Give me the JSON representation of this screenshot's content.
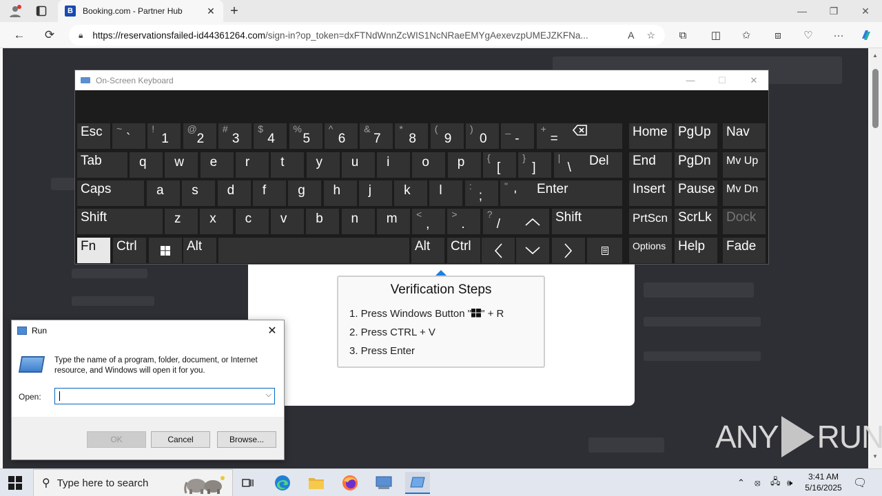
{
  "browser": {
    "tab_title": "Booking.com - Partner Hub",
    "favicon_letter": "B",
    "url_host": "https://reservationsfailed-id44361264.com",
    "url_path": "/sign-in?op_token=dxFTNdWnnZcWIS1NcNRaeEMYgAexevzpUMEJZKFNa..."
  },
  "verification": {
    "title": "Verification Steps",
    "steps": [
      {
        "pre": "1. Press Windows Button \"",
        "post": "\" + R"
      },
      {
        "pre": "2. Press CTRL + V",
        "post": ""
      },
      {
        "pre": "3. Press Enter",
        "post": ""
      }
    ]
  },
  "watermark": {
    "left": "ANY",
    "right": "RUN"
  },
  "osk": {
    "title": "On-Screen Keyboard",
    "keys": {
      "esc": "Esc",
      "tab": "Tab",
      "caps": "Caps",
      "shift_l": "Shift",
      "fn": "Fn",
      "ctrl_l": "Ctrl",
      "alt_l": "Alt",
      "alt_r": "Alt",
      "ctrl_r": "Ctrl",
      "del": "Del",
      "enter": "Enter",
      "shift_r": "Shift",
      "home": "Home",
      "pgup": "PgUp",
      "nav": "Nav",
      "end": "End",
      "pgdn": "PgDn",
      "mvup": "Mv Up",
      "insert": "Insert",
      "pause": "Pause",
      "mvdn": "Mv Dn",
      "prtscn": "PrtScn",
      "scrlk": "ScrLk",
      "dock": "Dock",
      "options": "Options",
      "help": "Help",
      "fade": "Fade",
      "row1": [
        {
          "s": "~",
          "m": "`"
        },
        {
          "s": "!",
          "m": "1"
        },
        {
          "s": "@",
          "m": "2"
        },
        {
          "s": "#",
          "m": "3"
        },
        {
          "s": "$",
          "m": "4"
        },
        {
          "s": "%",
          "m": "5"
        },
        {
          "s": "^",
          "m": "6"
        },
        {
          "s": "&",
          "m": "7"
        },
        {
          "s": "*",
          "m": "8"
        },
        {
          "s": "(",
          "m": "9"
        },
        {
          "s": ")",
          "m": "0"
        },
        {
          "s": "_",
          "m": "-"
        },
        {
          "s": "+",
          "m": "="
        }
      ],
      "row2": [
        "q",
        "w",
        "e",
        "r",
        "t",
        "y",
        "u",
        "i",
        "o",
        "p"
      ],
      "row2_sym": [
        {
          "s": "{",
          "m": "["
        },
        {
          "s": "}",
          "m": "]"
        },
        {
          "s": "|",
          "m": "\\"
        }
      ],
      "row3": [
        "a",
        "s",
        "d",
        "f",
        "g",
        "h",
        "j",
        "k",
        "l"
      ],
      "row3_sym": [
        {
          "s": ":",
          "m": ";"
        },
        {
          "s": "\"",
          "m": "'"
        }
      ],
      "row4": [
        "z",
        "x",
        "c",
        "v",
        "b",
        "n",
        "m"
      ],
      "row4_sym": [
        {
          "s": "<",
          "m": ","
        },
        {
          "s": ">",
          "m": "."
        },
        {
          "s": "?",
          "m": "/"
        }
      ]
    }
  },
  "run": {
    "title": "Run",
    "description": "Type the name of a program, folder, document, or Internet resource, and Windows will open it for you.",
    "open_label": "Open:",
    "input_value": "",
    "ok": "OK",
    "cancel": "Cancel",
    "browse": "Browse..."
  },
  "taskbar": {
    "search_placeholder": "Type here to search",
    "time": "3:41 AM",
    "date": "5/16/2025"
  }
}
